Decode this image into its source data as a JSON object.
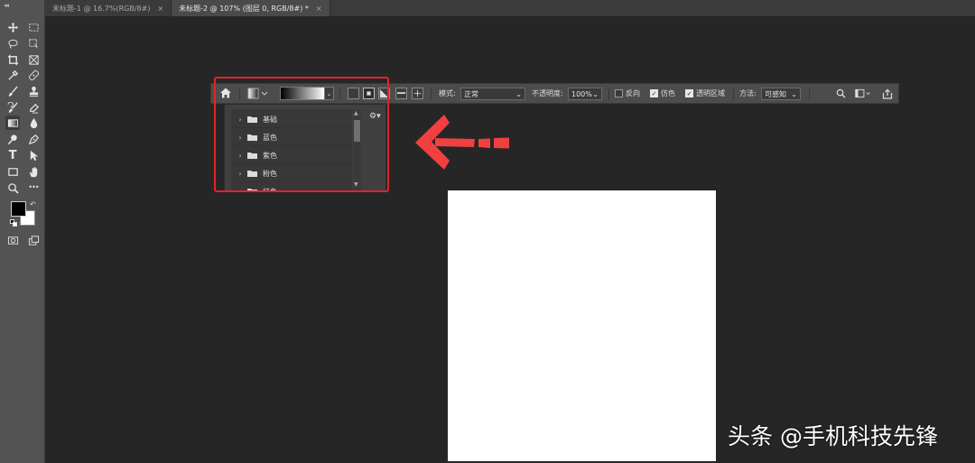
{
  "tabs": [
    {
      "label": "未标题-1 @ 16.7%(RGB/8#)",
      "close": "×",
      "active": false
    },
    {
      "label": "未标题-2 @ 107% (图层 0, RGB/8#) *",
      "close": "×",
      "active": true
    }
  ],
  "options_bar": {
    "mode_label": "模式:",
    "mode_value": "正常",
    "opacity_label": "不透明度:",
    "opacity_value": "100%",
    "reverse_label": "反向",
    "reverse_checked": false,
    "dither_label": "仿色",
    "dither_checked": true,
    "transparency_label": "透明区域",
    "transparency_checked": true,
    "method_label": "方法:",
    "method_value": "可感知",
    "dropdown_glyph": "⌄"
  },
  "gradient_presets": {
    "folders": [
      "基础",
      "蓝色",
      "紫色",
      "粉色",
      "红色"
    ],
    "gear_glyph": "⚙▾"
  },
  "colors": {
    "foreground": "#000000",
    "background": "#ffffff",
    "highlight": "#e0242b",
    "arrow": "#f04040"
  },
  "toolbar": {
    "tools": [
      "move-icon",
      "marquee-icon",
      "lasso-icon",
      "object-select-icon",
      "crop-icon",
      "frame-icon",
      "eyedropper-icon",
      "healing-brush-icon",
      "brush-icon",
      "stamp-icon",
      "history-brush-icon",
      "eraser-icon",
      "gradient-icon",
      "blur-icon",
      "dodge-icon",
      "pen-icon",
      "type-icon",
      "path-select-icon",
      "rectangle-icon",
      "hand-icon",
      "zoom-icon",
      "more-icon",
      "quick-mask-icon",
      "screen-mode-icon"
    ],
    "type_glyph": "T",
    "more_glyph": "•••"
  },
  "watermark": "头条 @手机科技先锋"
}
